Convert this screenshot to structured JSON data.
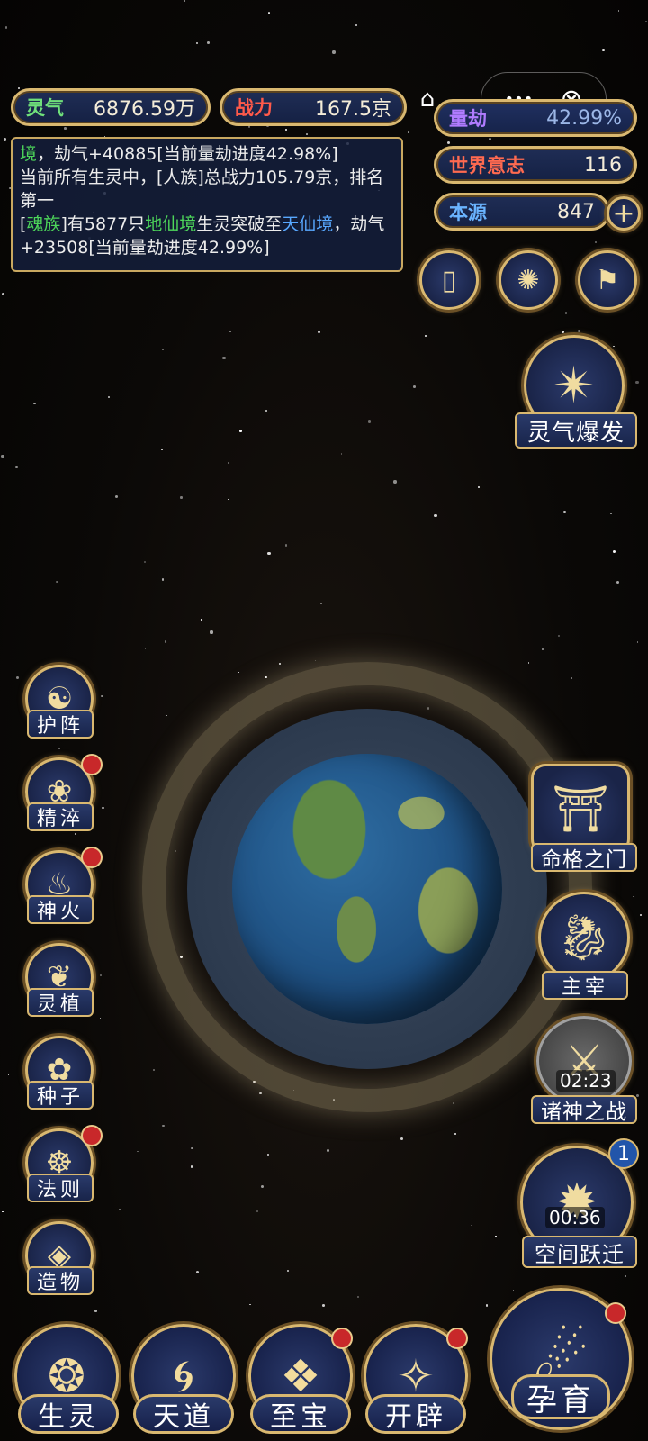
{
  "resources": {
    "lingqi": {
      "label": "灵气",
      "value": "6876.59万"
    },
    "zhanli": {
      "label": "战力",
      "value": "167.5京"
    },
    "liangjie": {
      "label": "量劫",
      "value": "42.99%"
    },
    "shijie": {
      "label": "世界意志",
      "value": "116"
    },
    "benyuan": {
      "label": "本源",
      "value": "847"
    }
  },
  "log": {
    "line1_a": "境",
    "line1_b": "，劫气+40885[当前量劫进度42.98%]",
    "line2": "当前所有生灵中，[人族]总战力105.79京，排名第一",
    "line3_a": "[",
    "line3_b": "魂族",
    "line3_c": "]有5877只",
    "line3_d": "地仙境",
    "line3_e": "生灵突破至",
    "line3_f": "天仙境",
    "line3_g": "，劫气+23508[当前量劫进度42.99%]"
  },
  "capsule": {
    "home_icon": "⌂",
    "more_icon": "•••",
    "close_icon": "⊗"
  },
  "right_buttons": {
    "lingqi_baofa": "灵气爆发",
    "mingge": "命格之门",
    "zhuzai": "主宰",
    "zhushen": "诸神之战",
    "zhushen_timer": "02:23",
    "kongjian": "空间跃迁",
    "kongjian_timer": "00:36",
    "kongjian_badge": "1"
  },
  "left_buttons": [
    {
      "label": "护阵",
      "icon": "☯"
    },
    {
      "label": "精淬",
      "icon": "❀"
    },
    {
      "label": "神火",
      "icon": "♨"
    },
    {
      "label": "灵植",
      "icon": "❦"
    },
    {
      "label": "种子",
      "icon": "✿"
    },
    {
      "label": "法则",
      "icon": "☸"
    },
    {
      "label": "造物",
      "icon": "◈"
    }
  ],
  "nav": {
    "shengling": "生灵",
    "tiandao": "天道",
    "zhibao": "至宝",
    "kaipi": "开辟",
    "yunyu": "孕育"
  },
  "colors": {
    "gold": "#d9b870",
    "navy": "#1a2448",
    "red": "#c8282a",
    "green": "#4dd65a",
    "blue": "#58a8ff"
  }
}
